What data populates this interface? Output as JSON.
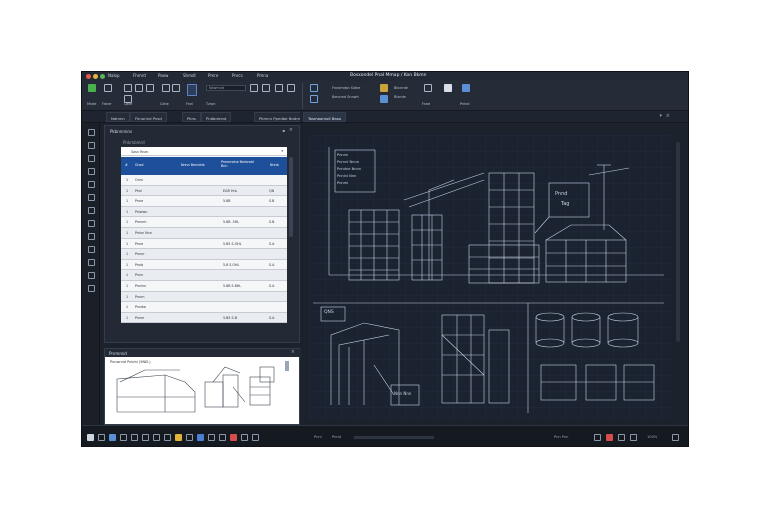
{
  "window": {
    "title": "Bosxondel Pnal Mmap / Kon Bkmn"
  },
  "menu": [
    "Nalop",
    "Fhmrd",
    "Paow",
    "Shmdl",
    "Pmre",
    "Pnrcs",
    "Pmna"
  ],
  "ribbon": {
    "groups": [
      {
        "label": "Mnde"
      },
      {
        "label": "Fdner"
      },
      {
        "label": "Qbnr"
      },
      {
        "label": "Cdne"
      },
      {
        "label": "Fnnl"
      },
      {
        "label": "Tzrpn"
      },
      {
        "label": "Fnnamdsn Sldne"
      },
      {
        "label": "Benvrnd Snnwh"
      },
      {
        "label": "Bkcnrde"
      },
      {
        "label": "Rlxnde"
      },
      {
        "label": "Fsne"
      },
      {
        "label": "Pnlnd"
      }
    ],
    "search_value": "Nawmnd"
  },
  "tabs": {
    "top_strip": [
      "Ndmnn",
      "Fknorlnd Pnsd",
      "Pkns",
      "Pndbnmnd",
      "Pkmnn Ppndbe Nndmnd"
    ],
    "canvas_tab": "Tosmaarvoll Baso"
  },
  "left_panel": {
    "title": "Pkbnnnnns",
    "filter_label": "Pnkmbmrd",
    "search_label": "Sasn Rnan",
    "columns": [
      "#",
      "Gnsd",
      "Nnnn Bmndnb",
      "Pnnmndne Nmbndd Bnn",
      "Nnnb"
    ],
    "rows": [
      {
        "id": "1",
        "name": "Onrn",
        "v1": "",
        "v2": ""
      },
      {
        "id": "1",
        "name": "Pnnl",
        "v1": "E&R HnL",
        "v2": "QN"
      },
      {
        "id": "1",
        "name": "Pnne",
        "v1": "5.8B",
        "v2": "S.B"
      },
      {
        "id": "1",
        "name": "Pnlwwn",
        "v1": "",
        "v2": ""
      },
      {
        "id": "1",
        "name": "Pnnnm",
        "v1": "5.8B .5HL",
        "v2": "S.B"
      },
      {
        "id": "1",
        "name": "Pnlnn Nnn",
        "v1": "",
        "v2": ""
      },
      {
        "id": "1",
        "name": "Pnne",
        "v1": "5.B5 S.OHL",
        "v2": "S.A"
      },
      {
        "id": "1",
        "name": "Pnnnr",
        "v1": "",
        "v2": ""
      },
      {
        "id": "1",
        "name": "Pnnb",
        "v1": "5.8 S.OHL",
        "v2": "S.A"
      },
      {
        "id": "1",
        "name": "Pnnn",
        "v1": "",
        "v2": ""
      },
      {
        "id": "1",
        "name": "Pnnlnn",
        "v1": "5.8B S.8HL",
        "v2": "S.A"
      },
      {
        "id": "1",
        "name": "Pnnrn",
        "v1": "",
        "v2": ""
      },
      {
        "id": "1",
        "name": "Pnndw",
        "v1": "",
        "v2": ""
      },
      {
        "id": "1",
        "name": "Pnnm",
        "v1": "5.B5 S.B",
        "v2": "S.A"
      }
    ]
  },
  "preview_panel": {
    "title": "Pnrmnnd",
    "caption": "Pnnwnnd Pnblnl (9NEL)"
  },
  "canvas": {
    "legend": [
      "Pnnnn",
      "Pnrnnl Nnnn",
      "Pnndne Nnnn",
      "Pnnlnl Nnn",
      "Pnnml"
    ],
    "callout": [
      "Pnnd",
      "Tag"
    ],
    "label_a": "QNS",
    "label_b": "Nnn Nnn"
  },
  "statusbar": {
    "items": [
      "Pnnl",
      "Pnnd",
      "Pnn Pnn"
    ],
    "right_text": "100%"
  },
  "colors": {
    "accent": "#1e4f9a",
    "drawing": "#c8d4e6",
    "background": "#1c222c"
  }
}
